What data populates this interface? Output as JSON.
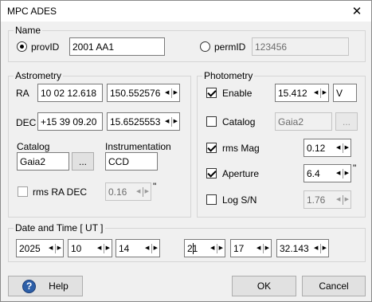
{
  "window": {
    "title": "MPC ADES",
    "close_glyph": "✕"
  },
  "name_group": {
    "label": "Name",
    "provid_label": "provID",
    "provid_value": "2001 AA1",
    "permid_label": "permID",
    "permid_value": "123456"
  },
  "astrometry": {
    "label": "Astrometry",
    "ra_label": "RA",
    "ra_sexagesimal": "10 02 12.618",
    "ra_decimal": "150.552576",
    "dec_label": "DEC",
    "dec_sexagesimal": "+15 39 09.20",
    "dec_decimal": "15.6525553",
    "catalog_label": "Catalog",
    "catalog_value": "Gaia2",
    "browse_label": "...",
    "instrumentation_label": "Instrumentation",
    "instrumentation_value": "CCD",
    "rms_radec_label": "rms RA DEC",
    "rms_radec_value": "0.16",
    "rms_radec_unit": "\""
  },
  "photometry": {
    "label": "Photometry",
    "enable_label": "Enable",
    "enable_value": "15.412",
    "band_value": "V",
    "catalog_label": "Catalog",
    "catalog_value": "Gaia2",
    "browse_label": "...",
    "rms_mag_label": "rms Mag",
    "rms_mag_value": "0.12",
    "aperture_label": "Aperture",
    "aperture_value": "6.4",
    "aperture_unit": "\"",
    "log_sn_label": "Log S/N",
    "log_sn_value": "1.76"
  },
  "datetime": {
    "label": "Date and Time  [ UT ]",
    "year": "2025",
    "month": "10",
    "day": "14",
    "hour": "21",
    "minute": "17",
    "second": "32.143"
  },
  "footer": {
    "help_label": "Help",
    "help_icon": "?",
    "ok_label": "OK",
    "cancel_label": "Cancel"
  },
  "icons": {
    "spin_left": "◀",
    "spin_right": "▶"
  }
}
